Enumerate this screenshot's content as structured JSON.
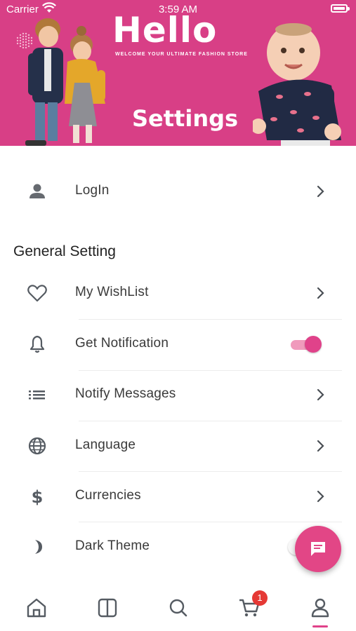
{
  "status_bar": {
    "carrier": "Carrier",
    "time": "3:59 AM"
  },
  "banner": {
    "brand": "Hello",
    "tagline": "WELCOME YOUR ULTIMATE FASHION STORE",
    "title": "Settings",
    "background": "#d83f86"
  },
  "account": {
    "login_label": "LogIn"
  },
  "general": {
    "title": "General Setting",
    "items": [
      {
        "label": "My WishList",
        "icon": "heart-icon"
      },
      {
        "label": "Get Notification",
        "icon": "bell-icon",
        "toggle": true
      },
      {
        "label": "Notify Messages",
        "icon": "list-icon"
      },
      {
        "label": "Language",
        "icon": "globe-icon"
      },
      {
        "label": "Currencies",
        "icon": "dollar-icon"
      },
      {
        "label": "Dark Theme",
        "icon": "moon-icon",
        "toggle": false
      }
    ]
  },
  "tabbar": {
    "items": [
      "home-icon",
      "categories-icon",
      "search-icon",
      "cart-icon",
      "profile-icon"
    ],
    "cart_badge": "1"
  },
  "accent": "#e0428a"
}
